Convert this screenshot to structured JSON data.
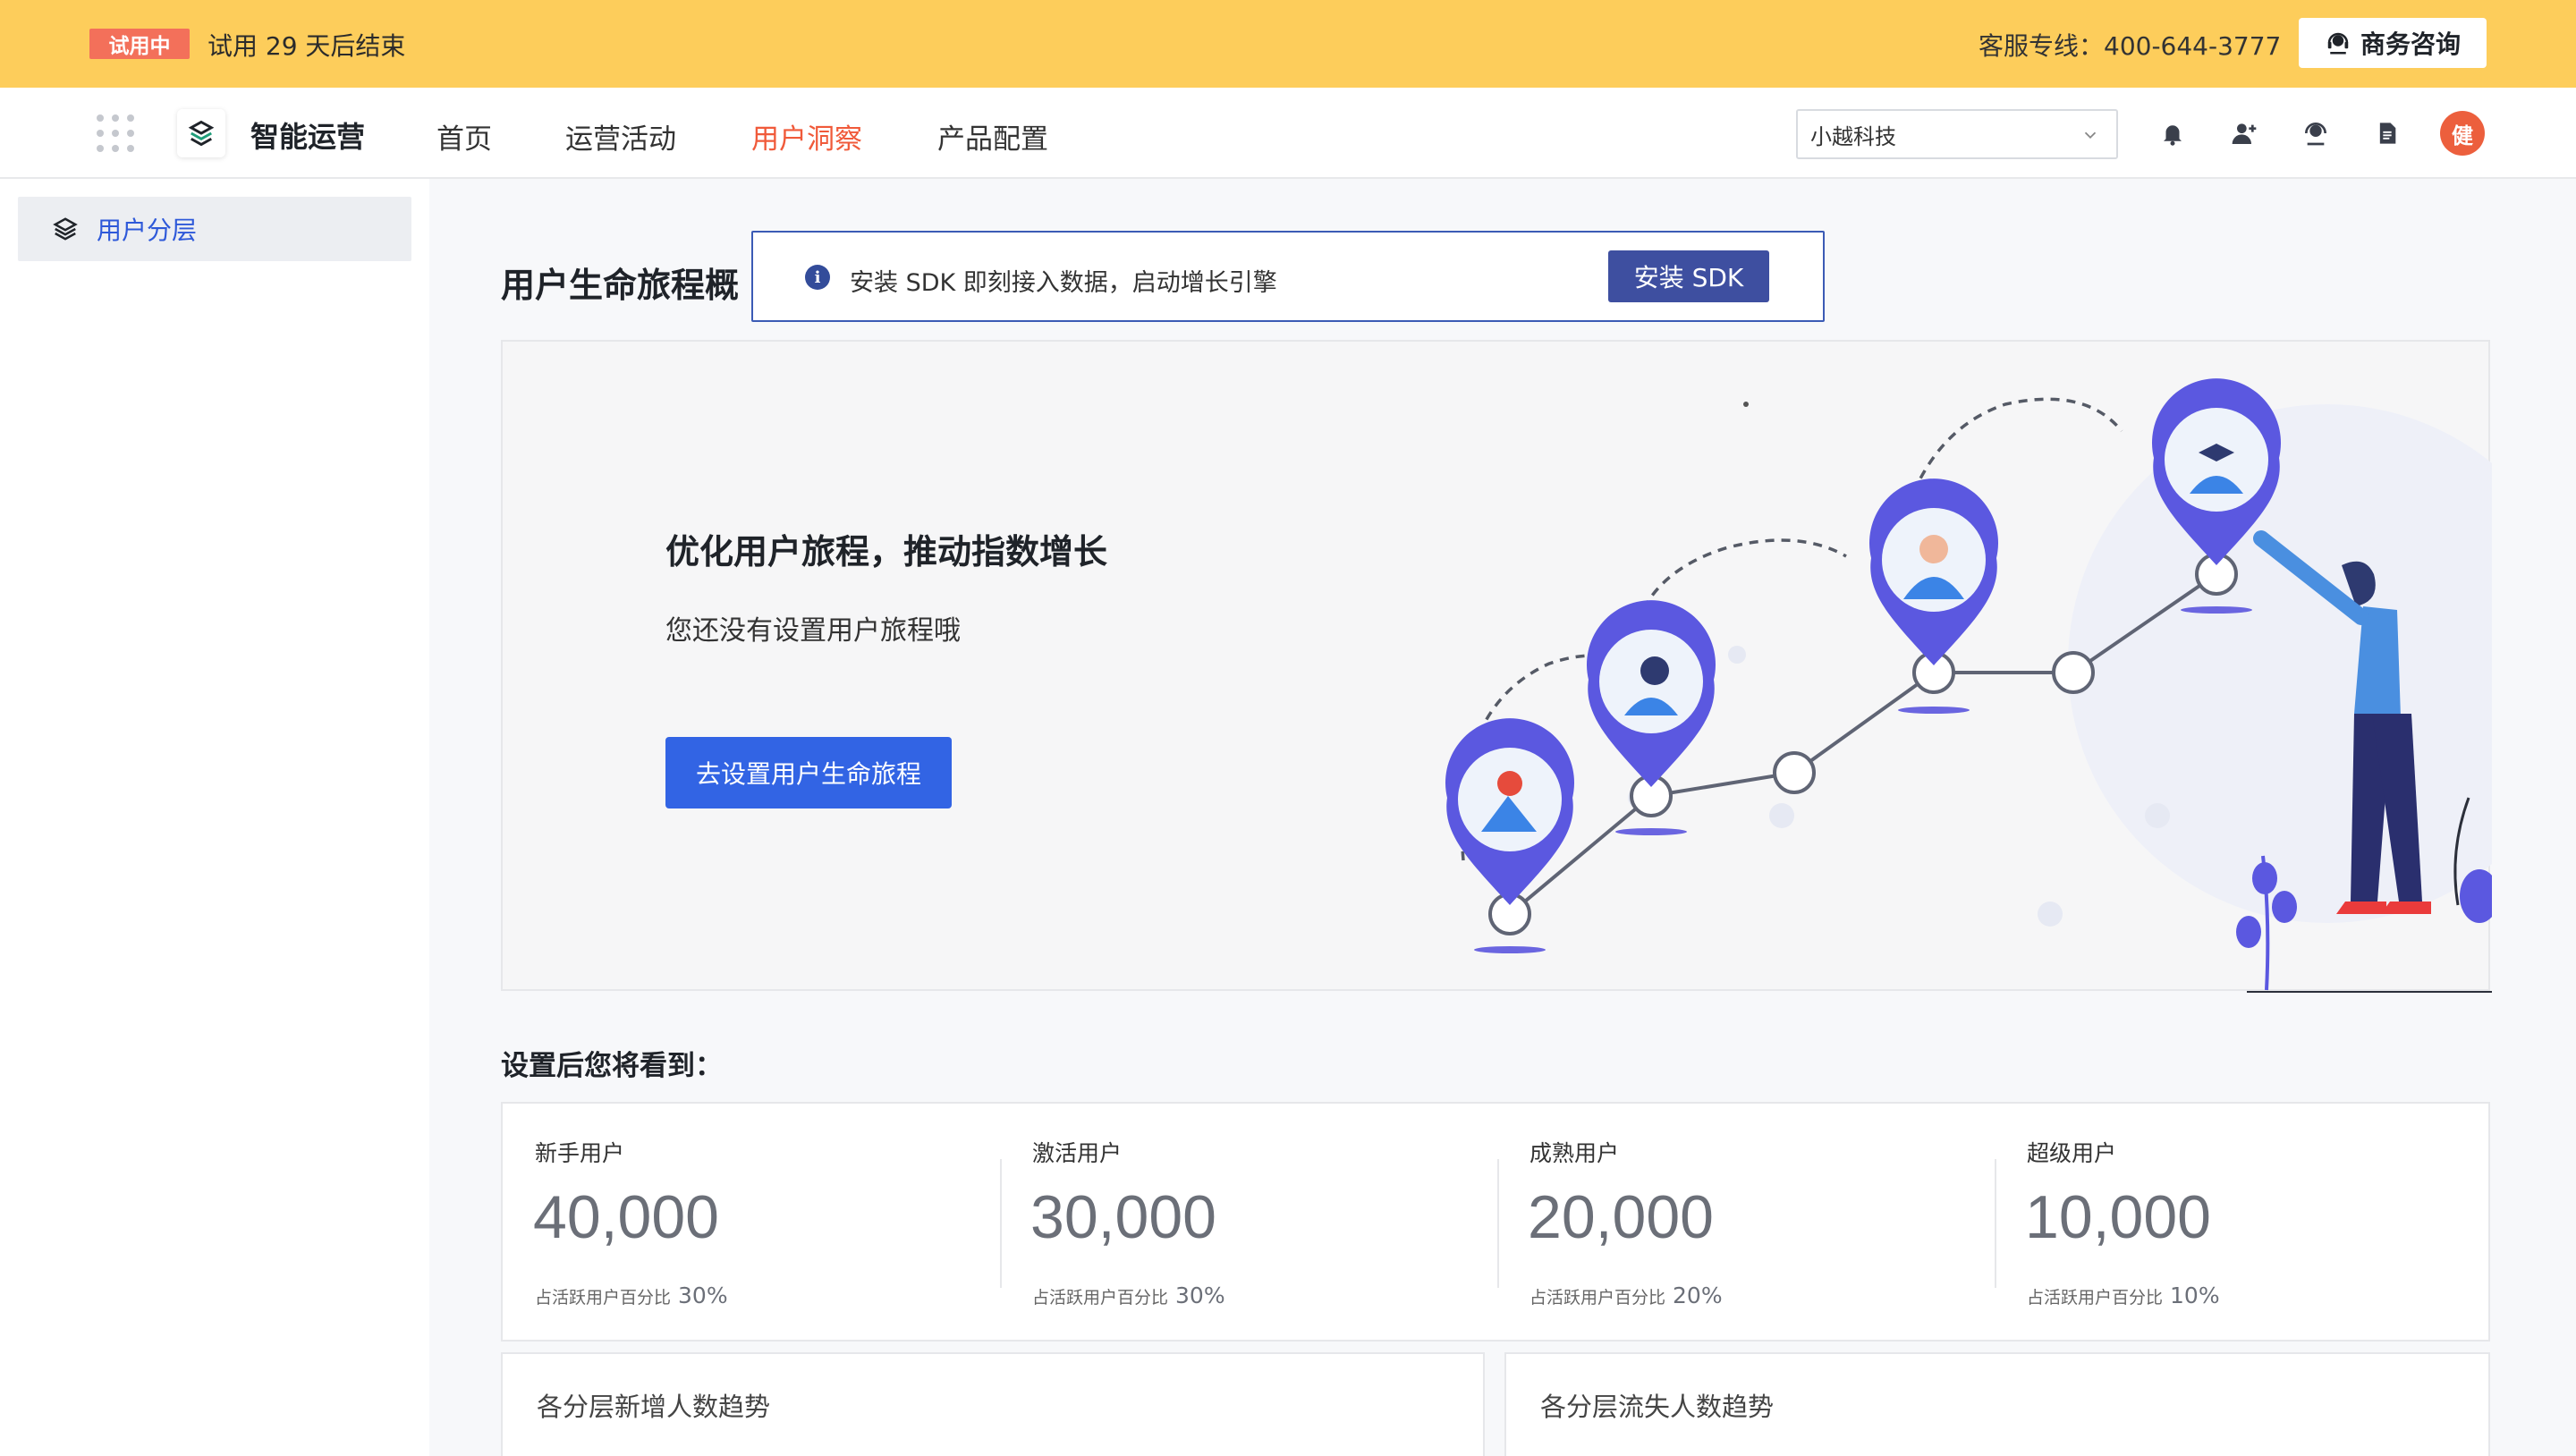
{
  "trial": {
    "tag": "试用中",
    "text": "试用 29 天后结束"
  },
  "hotline": "客服专线：400-644-3777",
  "biz_consult": "商务咨询",
  "nav": {
    "app_name": "智能运营",
    "links": [
      "首页",
      "运营活动",
      "用户洞察",
      "产品配置"
    ],
    "active": "用户洞察",
    "org_select": "小越科技",
    "avatar": "健"
  },
  "sidebar": {
    "items": [
      {
        "label": "用户分层",
        "icon": "layers-icon"
      }
    ]
  },
  "page_title": "用户生命旅程概",
  "sdk_banner": {
    "text": "安装 SDK 即刻接入数据，启动增长引擎",
    "button": "安装 SDK"
  },
  "hero": {
    "title": "优化用户旅程，推动指数增长",
    "subtitle": "您还没有设置用户旅程哦",
    "button": "去设置用户生命旅程"
  },
  "preview_title": "设置后您将看到：",
  "stats": [
    {
      "label": "新手用户",
      "value": "40,000",
      "foot_label": "占活跃用户百分比",
      "pct": "30%"
    },
    {
      "label": "激活用户",
      "value": "30,000",
      "foot_label": "占活跃用户百分比",
      "pct": "30%"
    },
    {
      "label": "成熟用户",
      "value": "20,000",
      "foot_label": "占活跃用户百分比",
      "pct": "20%"
    },
    {
      "label": "超级用户",
      "value": "10,000",
      "foot_label": "占活跃用户百分比",
      "pct": "10%"
    }
  ],
  "trends": [
    "各分层新增人数趋势",
    "各分层流失人数趋势"
  ],
  "colors": {
    "banner": "#fdcd5b",
    "trial_tag": "#f3705a",
    "active_nav": "#f05a3a",
    "primary": "#3264e4",
    "sdk_btn": "#3e4fa0",
    "avatar": "#ec5f3d"
  }
}
